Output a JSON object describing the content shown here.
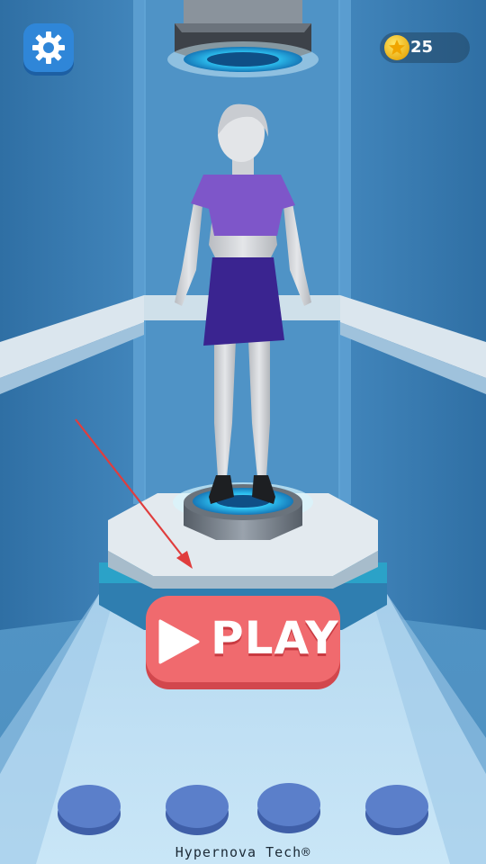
{
  "hud": {
    "settings_icon": "gear-icon",
    "coins": "25",
    "coin_icon": "gold-star-coin-icon"
  },
  "play_button": {
    "label": "PLAY",
    "icon": "play-triangle-icon"
  },
  "footer": {
    "brand": "Hypernova Tech®"
  },
  "colors": {
    "background": "#3f84b8",
    "play_button": "#f06a6e",
    "settings_button": "#2f86d8",
    "pads": "#5b7fca",
    "top": "#7e56c9",
    "skirt": "#3a2490"
  }
}
